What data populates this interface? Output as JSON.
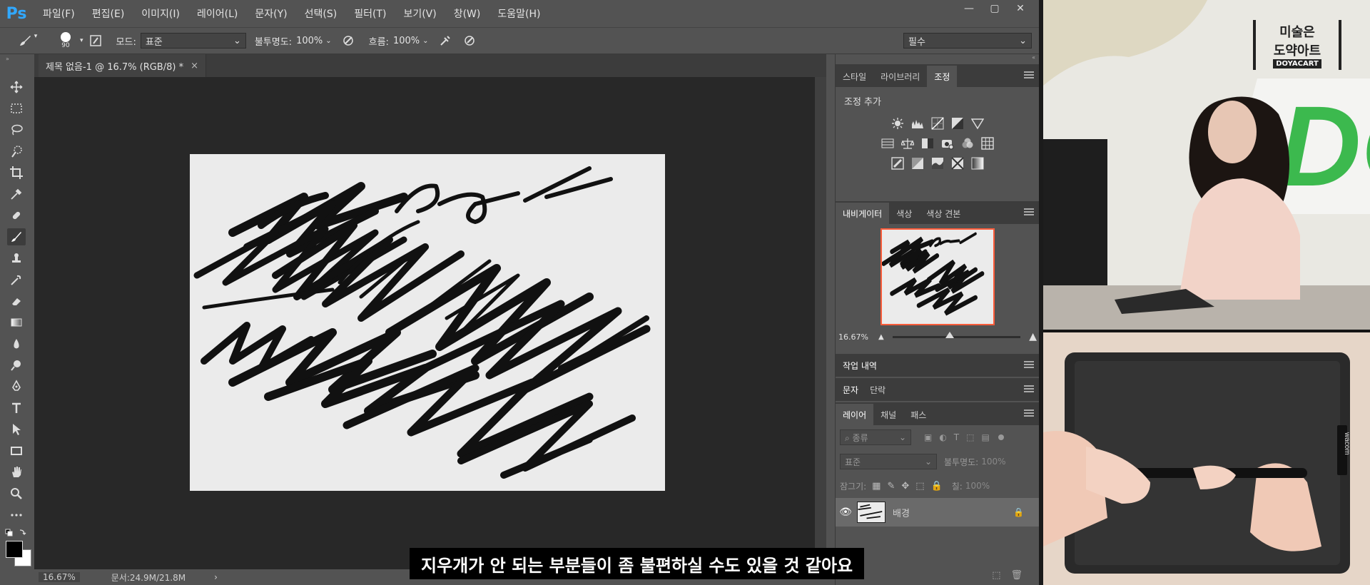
{
  "app": {
    "logo": "Ps",
    "menu": [
      "파일(F)",
      "편집(E)",
      "이미지(I)",
      "레이어(L)",
      "문자(Y)",
      "선택(S)",
      "필터(T)",
      "보기(V)",
      "창(W)",
      "도움말(H)"
    ],
    "window_controls": [
      "—",
      "▢",
      "✕"
    ]
  },
  "options": {
    "brush_size": "90",
    "mode_label": "모드:",
    "mode_value": "표준",
    "opacity_label": "불투명도:",
    "opacity_value": "100%",
    "flow_label": "흐름:",
    "flow_value": "100%",
    "workspace": "필수"
  },
  "document": {
    "tab_title": "제목 없음-1 @ 16.7% (RGB/8) *",
    "tab_close": "×"
  },
  "status": {
    "zoom": "16.67%",
    "doc_info": "문서:24.9M/21.8M",
    "arrow": "›"
  },
  "panels": {
    "group1_tabs": [
      "스타일",
      "라이브러리",
      "조정"
    ],
    "adjust_title": "조정 추가",
    "group2_tabs": [
      "내비게이터",
      "색상",
      "색상 견본"
    ],
    "nav_zoom": "16.67%",
    "nav_zoom_fraction": 0.45,
    "history_tab": "작업 내역",
    "text_tabs": [
      "문자",
      "단락"
    ],
    "layer_tabs": [
      "레이어",
      "채널",
      "패스"
    ],
    "layer_filter": "종류",
    "blend_mode": "표준",
    "opacity_label": "불투명도:",
    "opacity_value": "100%",
    "lock_label": "잠그기:",
    "fill_label": "칠:",
    "fill_value": "100%",
    "layer_name": "배경"
  },
  "camera": {
    "logo_line1": "미술은",
    "logo_line2": "도약아트",
    "logo_brand": "DOYACART",
    "wall_text": "DO",
    "tablet_brand": "wacom"
  },
  "subtitle": "지우개가 안 되는 부분들이 좀 불편하실 수도 있을 것 같아요",
  "colors": {
    "ps_panel": "#535353",
    "canvas_bg": "#282828",
    "paper": "#ebebeb",
    "accent_ps": "#31a8ff",
    "nav_frame": "#ff5c3a",
    "wall_green": "#3cb94e"
  }
}
